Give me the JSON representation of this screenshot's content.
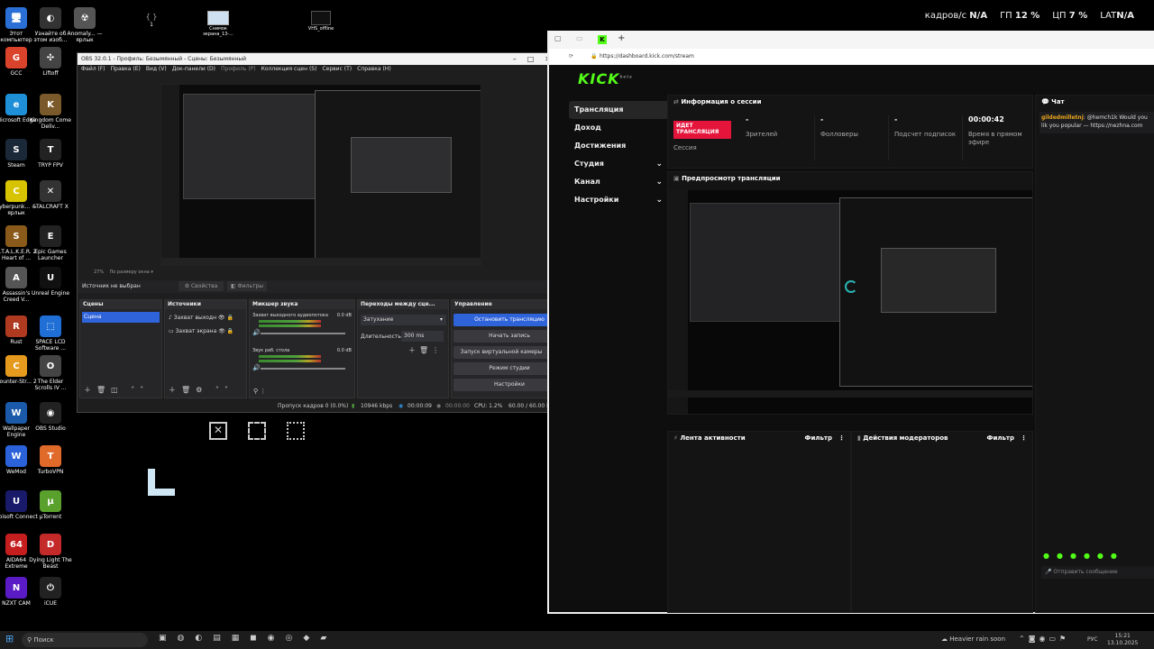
{
  "overlay": {
    "fps_label": "кадров/с",
    "fps_value": "N/A",
    "gpu_label": "ГП",
    "gpu_value": "12 %",
    "cpu_label": "ЦП",
    "cpu_value": "7 %",
    "lat_label": "LAT",
    "lat_value": "N/A"
  },
  "desktop_icons": [
    {
      "label": "Этот компьютер",
      "color": "#2a6fd6",
      "glyph": "🖥"
    },
    {
      "label": "Узнайте об этом изоб...",
      "color": "#333",
      "glyph": "◐"
    },
    {
      "label": "Anomaly... — ярлык",
      "color": "#555",
      "glyph": "☢"
    },
    {
      "label": "GCC",
      "color": "#d9432b",
      "glyph": "G"
    },
    {
      "label": "Liftoff",
      "color": "#444",
      "glyph": "✣"
    },
    {
      "label": "Microsoft Edge",
      "color": "#1f8fd8",
      "glyph": "e"
    },
    {
      "label": "Kingdom Come Deliv...",
      "color": "#7a5a2a",
      "glyph": "K"
    },
    {
      "label": "Steam",
      "color": "#1b2838",
      "glyph": "S"
    },
    {
      "label": "TRYP FPV",
      "color": "#222",
      "glyph": "T"
    },
    {
      "label": "Cyberpunk... — ярлык",
      "color": "#d8c300",
      "glyph": "C"
    },
    {
      "label": "STALCRAFT X",
      "color": "#333",
      "glyph": "✕"
    },
    {
      "label": "S.T.A.L.K.E.R. 2 Heart of ...",
      "color": "#8a5a1a",
      "glyph": "S"
    },
    {
      "label": "Epic Games Launcher",
      "color": "#222",
      "glyph": "E"
    },
    {
      "label": "Assassin's Creed V...",
      "color": "#555",
      "glyph": "A"
    },
    {
      "label": "Unreal Engine",
      "color": "#111",
      "glyph": "U"
    },
    {
      "label": "Rust",
      "color": "#b03a20",
      "glyph": "R"
    },
    {
      "label": "SPACE LCD Software ...",
      "color": "#1f6fd6",
      "glyph": "⬚"
    },
    {
      "label": "Counter-Str... 2",
      "color": "#e59a1d",
      "glyph": "C"
    },
    {
      "label": "The Elder Scrolls IV ...",
      "color": "#444",
      "glyph": "O"
    },
    {
      "label": "Wallpaper Engine",
      "color": "#1a5aa8",
      "glyph": "W"
    },
    {
      "label": "OBS Studio",
      "color": "#222",
      "glyph": "◉"
    },
    {
      "label": "WeMod",
      "color": "#2b62d9",
      "glyph": "W"
    },
    {
      "label": "TurboVPN",
      "color": "#e06a2a",
      "glyph": "T"
    },
    {
      "label": "Ubisoft Connect",
      "color": "#1a1a6a",
      "glyph": "U"
    },
    {
      "label": "µTorrent",
      "color": "#5aa02c",
      "glyph": "µ"
    },
    {
      "label": "AIDA64 Extreme",
      "color": "#c41e1e",
      "glyph": "64"
    },
    {
      "label": "Dying Light The Beast",
      "color": "#c42a2a",
      "glyph": "D"
    },
    {
      "label": "NZXT CAM",
      "color": "#5a1ac4",
      "glyph": "N"
    },
    {
      "label": "iCUE",
      "color": "#222",
      "glyph": "⏻"
    }
  ],
  "top_icons": [
    {
      "label": "1"
    },
    {
      "label": "Снимок экрана_13-..."
    },
    {
      "label": "VHS_offline"
    }
  ],
  "obs": {
    "title": "OBS 32.0.1 - Профиль: Безымянный - Сцены: Безымянный",
    "menu": [
      "Файл (F)",
      "Правка (E)",
      "Вид (V)",
      "Док-панели (D)",
      "Профиль (P)",
      "Коллекция сцен (S)",
      "Сервис (T)",
      "Справка (H)"
    ],
    "zoom": "27%",
    "zoom_mode": "По размеру окна",
    "no_source": "Источник не выбран",
    "properties": "Свойства",
    "filters": "Фильтры",
    "scenes_title": "Сцены",
    "scene_item": "Сцена",
    "sources_title": "Источники",
    "sources": [
      "Захват выходн",
      "Захват экрана"
    ],
    "mixer_title": "Микшер звука",
    "mixer": [
      {
        "name": "Захват выходного аудиопотока",
        "db": "0.0 dB",
        "level": 0.72
      },
      {
        "name": "Звук раб. стола",
        "db": "0.0 dB",
        "level": 0.72
      }
    ],
    "transitions_title": "Переходы между сце...",
    "transition": "Затухание",
    "duration_label": "Длительность",
    "duration_value": "300 ms",
    "controls_title": "Управление",
    "controls": [
      "Остановить трансляцию",
      "Начать запись",
      "Запуск виртуальной камеры",
      "Режим студии",
      "Настройки"
    ],
    "status": {
      "dropped": "Пропуск кадров 0 (0.0%)",
      "bitrate": "10946 kbps",
      "live_time": "00:00:09",
      "rec_time": "00:00:00",
      "cpu": "CPU: 1.2%",
      "fps": "60.00 / 60.00 FPS"
    }
  },
  "browser": {
    "url": "https://dashboard.kick.com/stream",
    "logo": "KICK",
    "logo_sup": "beta",
    "nav": [
      {
        "label": "Трансляция",
        "active": true,
        "chevron": false
      },
      {
        "label": "Доход",
        "active": false,
        "chevron": false
      },
      {
        "label": "Достижения",
        "active": false,
        "chevron": false
      },
      {
        "label": "Студия",
        "active": false,
        "chevron": true
      },
      {
        "label": "Канал",
        "active": false,
        "chevron": true
      },
      {
        "label": "Настройки",
        "active": false,
        "chevron": true
      }
    ],
    "session": {
      "title": "Информация о сессии",
      "live_badge": "ИДЕТ ТРАНСЛЯЦИЯ",
      "session_label": "Сессия",
      "stats": [
        {
          "value": "-",
          "label": "Зрителей"
        },
        {
          "value": "-",
          "label": "Фолловеры"
        },
        {
          "value": "-",
          "label": "Подсчет подписок"
        },
        {
          "value": "00:00:42",
          "label": "Время в прямом эфире"
        }
      ]
    },
    "preview_title": "Предпросмотр трансляции",
    "activity_title": "Лента активности",
    "activity_filter": "Фильтр",
    "mod_title": "Действия модераторов",
    "mod_filter": "Фильтр",
    "chat": {
      "title": "Чат",
      "user": "gildedmilletnj",
      "message": ": @hemch1k Would you lik you popular — https://nezhna.com",
      "input_placeholder": "Отправить сообщение"
    }
  },
  "taskbar": {
    "search_placeholder": "Поиск",
    "weather": "Heavier rain soon",
    "lang": "РУС",
    "time": "15:21",
    "date": "13.10.2025"
  },
  "colors": {
    "kick_green": "#53fc18",
    "obs_accent": "#2f63d9",
    "live_red": "#e5143b"
  }
}
